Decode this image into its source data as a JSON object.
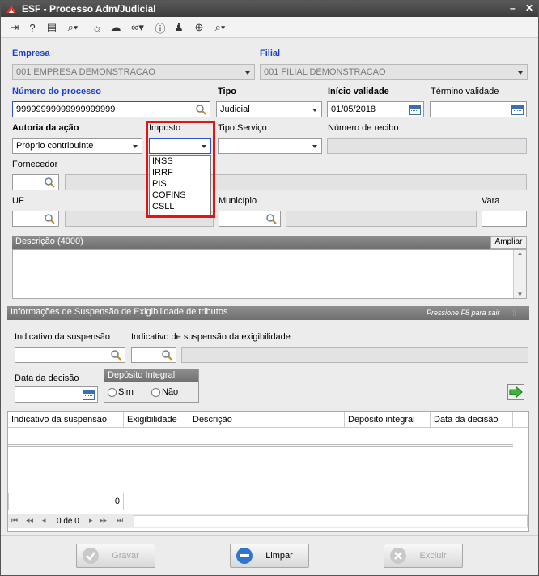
{
  "window": {
    "title": "ESF - Processo Adm/Judicial"
  },
  "toolbar": {
    "icons": [
      "exit-icon",
      "help-icon",
      "info-chat-icon",
      "search-icon",
      "lightbulb-icon",
      "cloud-icon",
      "link-icon",
      "info-icon",
      "user-icon",
      "add-document-icon",
      "zoom-icon"
    ]
  },
  "form": {
    "empresa_label": "Empresa",
    "empresa_value": "001 EMPRESA DEMONSTRACAO",
    "filial_label": "Filial",
    "filial_value": "001 FILIAL DEMONSTRACAO",
    "numero_label": "Número do processo",
    "numero_value": "99999999999999999999",
    "tipo_label": "Tipo",
    "tipo_value": "Judicial",
    "inicio_label": "Início validade",
    "inicio_value": "01/05/2018",
    "termino_label": "Término validade",
    "termino_value": "",
    "autoria_label": "Autoria da ação",
    "autoria_value": "Próprio contribuinte",
    "imposto_label": "Imposto",
    "imposto_value": "",
    "imposto_options": [
      "INSS",
      "IRRF",
      "PIS",
      "COFINS",
      "CSLL"
    ],
    "tiposervico_label": "Tipo Serviço",
    "tiposervico_value": "",
    "recibo_label": "Número de recibo",
    "fornecedor_label": "Fornecedor",
    "uf_label": "UF",
    "municipio_label": "Município",
    "vara_label": "Vara",
    "descricao_label": "Descrição (4000)",
    "ampliar_label": "Ampliar"
  },
  "suspensao": {
    "header": "Informações de Suspensão de Exigibilidade de tributos",
    "hint": "Pressione F8 para sair",
    "indicativo_label": "Indicativo da suspensão",
    "indicativo_exig_label": "Indicativo de suspensão da exigibilidade",
    "data_decisao_label": "Data da decisão",
    "deposito_label": "Depósito Integral",
    "sim_label": "Sim",
    "nao_label": "Não",
    "table_headers": [
      "Indicativo da suspensão",
      "Exigibilidade",
      "Descrição",
      "Depósito integral",
      "Data da decisão"
    ],
    "count_value": "0",
    "pager_text": "0 de 0"
  },
  "buttons": {
    "gravar": "Gravar",
    "limpar": "Limpar",
    "excluir": "Excluir"
  }
}
